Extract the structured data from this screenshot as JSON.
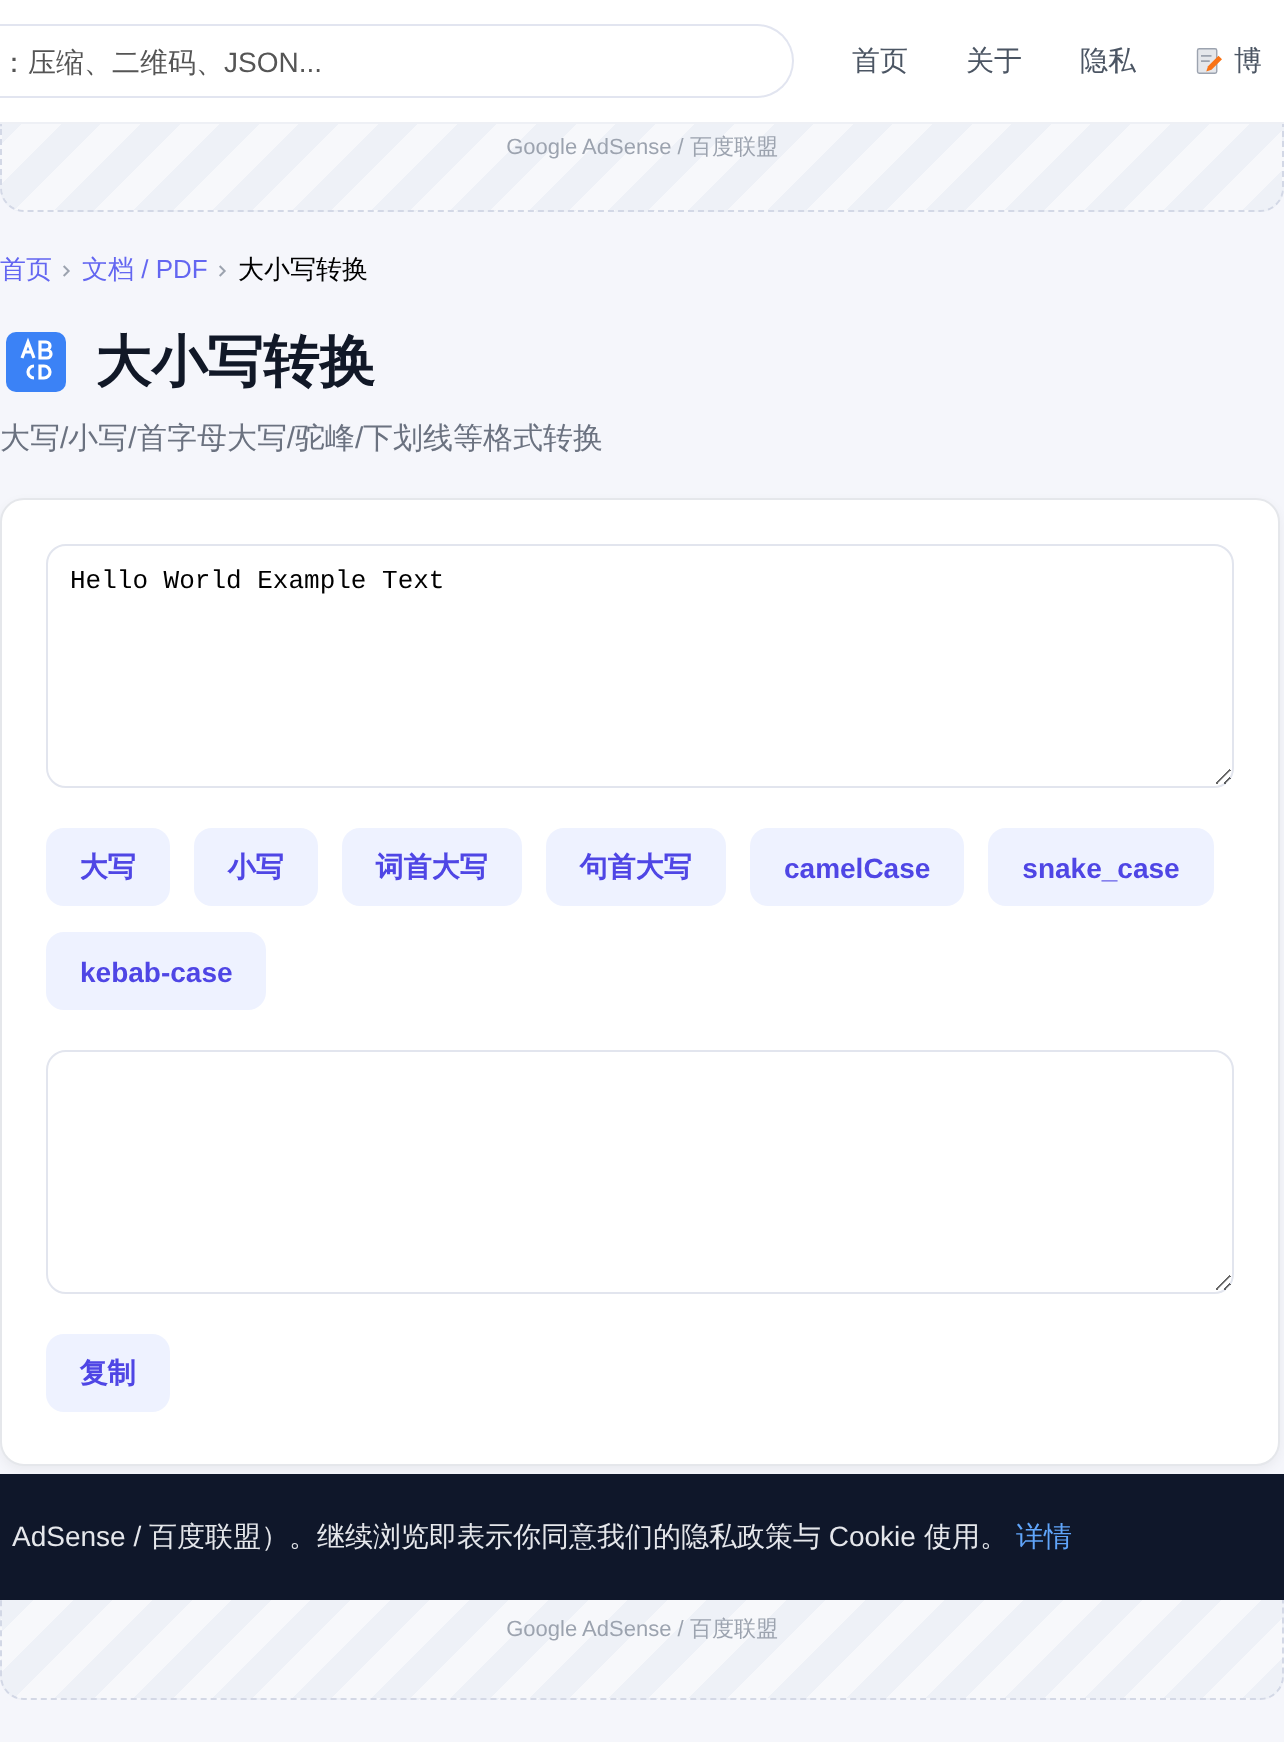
{
  "header": {
    "search": {
      "placeholder": "：压缩、二维码、JSON..."
    },
    "nav": [
      {
        "label": "首页",
        "kind": "text"
      },
      {
        "label": "关于",
        "kind": "text"
      },
      {
        "label": "隐私",
        "kind": "text"
      },
      {
        "label": "博",
        "kind": "blog"
      }
    ]
  },
  "ads": [
    {
      "label": "Google AdSense / 百度联盟"
    },
    {
      "label": "Google AdSense / 百度联盟"
    }
  ],
  "breadcrumb": [
    {
      "label": "首页",
      "link": true
    },
    {
      "label": "文档 / PDF",
      "link": true
    },
    {
      "label": "大小写转换",
      "link": false
    }
  ],
  "title": "大小写转换",
  "subtitle": "大写/小写/首字母大写/驼峰/下划线等格式转换",
  "input": {
    "value": "Hello World Example Text"
  },
  "modes": [
    {
      "label": "大写"
    },
    {
      "label": "小写"
    },
    {
      "label": "词首大写"
    },
    {
      "label": "句首大写"
    },
    {
      "label": "camelCase"
    },
    {
      "label": "snake_case"
    },
    {
      "label": "kebab-case"
    }
  ],
  "copy_button": "复制",
  "cookie_banner": {
    "text": "AdSense / 百度联盟）。继续浏览即表示你同意我们的隐私政策与 Cookie 使用。",
    "link": "详情"
  }
}
